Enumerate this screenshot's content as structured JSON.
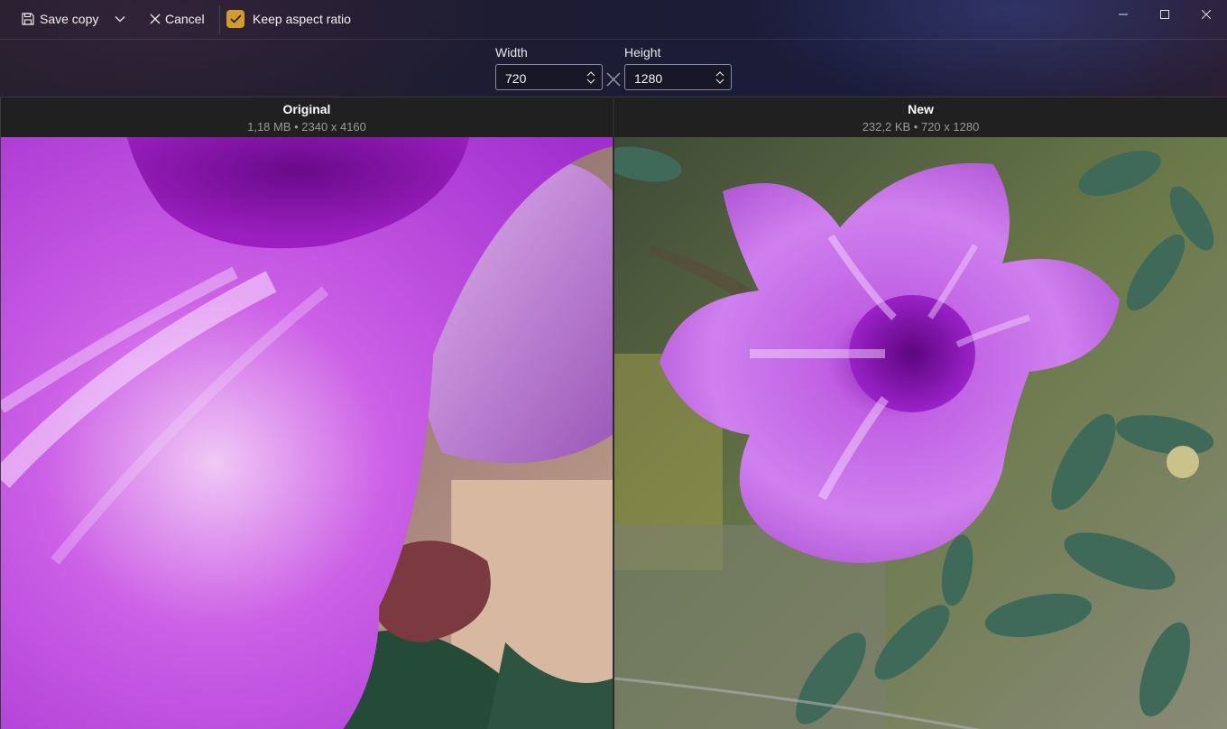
{
  "toolbar": {
    "save_label": "Save copy",
    "cancel_label": "Cancel",
    "keep_aspect_label": "Keep aspect ratio",
    "keep_aspect_checked": true
  },
  "window_controls": [
    "minimize-icon",
    "maximize-icon",
    "close-icon"
  ],
  "resize": {
    "width_label": "Width",
    "width_value": "720",
    "height_label": "Height",
    "height_value": "1280"
  },
  "panes": {
    "original": {
      "title": "Original",
      "meta": "1,18 MB • 2340 x 4160"
    },
    "new": {
      "title": "New",
      "meta": "232,2 KB • 720 x 1280"
    }
  },
  "colors": {
    "accent": "#d49a2a",
    "pane_header": "#202020"
  }
}
